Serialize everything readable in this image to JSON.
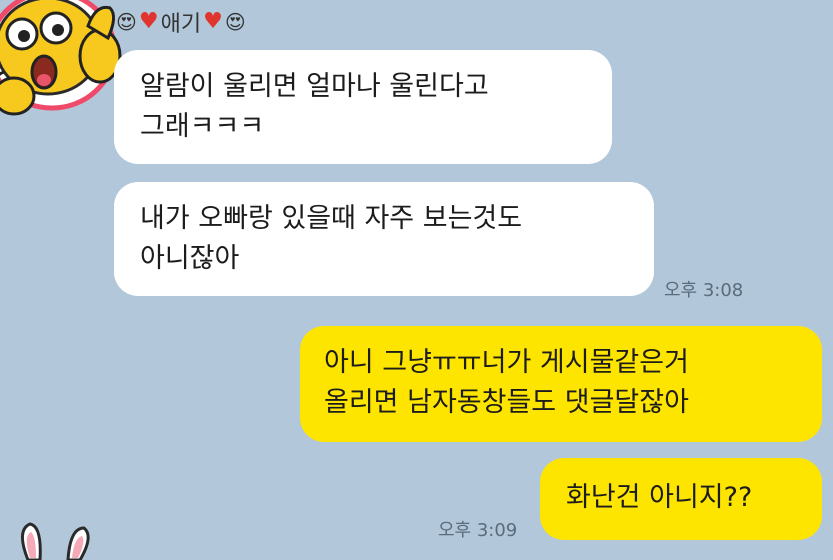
{
  "chat": {
    "sender_name": "애기",
    "sender_decorations": [
      "heart-eyes-emoji",
      "heart",
      "heart",
      "heart-eyes-emoji"
    ],
    "incoming": [
      {
        "lines": [
          "알람이 울리면 얼마나 울린다고",
          "그래ㅋㅋㅋ"
        ]
      },
      {
        "lines": [
          "내가 오빠랑 있을때 자주 보는것도",
          "아니잖아"
        ],
        "time": "오후 3:08"
      }
    ],
    "outgoing": [
      {
        "lines": [
          "아니 그냥ㅠㅠ너가 게시물같은거",
          "올리면 남자동창들도 댓글달잖아"
        ]
      },
      {
        "lines": [
          "화난건 아니지??"
        ],
        "time": "오후 3:09"
      }
    ]
  },
  "colors": {
    "background": "#b2c7da",
    "incoming_bubble": "#ffffff",
    "outgoing_bubble": "#fee500",
    "heart": "#e0342f"
  }
}
